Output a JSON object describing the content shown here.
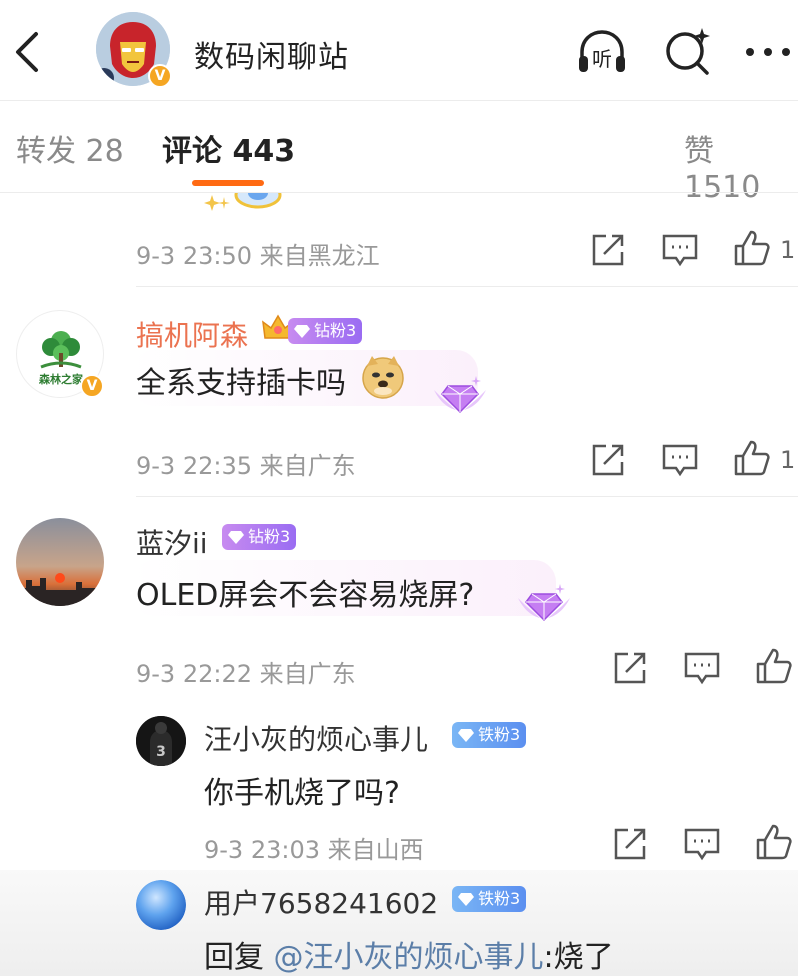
{
  "header": {
    "title": "数码闲聊站",
    "listen_label": "听"
  },
  "tabs": {
    "repost": "转发 28",
    "comments": "评论 443",
    "likes": "赞 1510"
  },
  "comments": [
    {
      "meta": "9-3 23:50  来自黑龙江",
      "likes": "1"
    },
    {
      "username": "搞机阿森",
      "badge": "钻粉3",
      "avatar_text": "森林之家",
      "text": "全系支持插卡吗",
      "meta": "9-3 22:35  来自广东",
      "likes": "1"
    },
    {
      "username": "蓝汐ii",
      "badge": "钻粉3",
      "text": "OLED屏会不会容易烧屏?",
      "meta": "9-3 22:22  来自广东"
    }
  ],
  "replies": [
    {
      "username": "汪小灰的烦心事儿",
      "badge": "铁粉3",
      "avatar_text": "3",
      "text": "你手机烧了吗?",
      "meta": "9-3 23:03  来自山西"
    },
    {
      "username": "用户7658241602",
      "badge": "铁粉3",
      "text_prefix": "回复 ",
      "mention": "@汪小灰的烦心事儿",
      "text_suffix": ":烧了"
    }
  ],
  "colors": {
    "accent": "#ff6a13",
    "username_highlight": "#eb7350",
    "diamond_badge": "#b07cf0",
    "iron_badge": "#6aa2f2",
    "link": "#5b7ea8"
  }
}
